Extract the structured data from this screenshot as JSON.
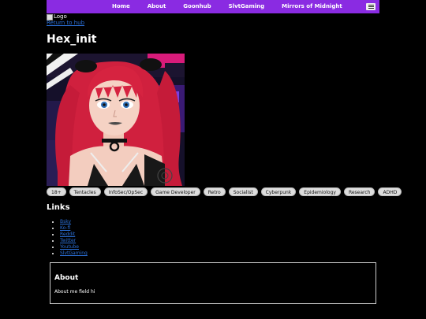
{
  "nav": {
    "items": [
      "Home",
      "About",
      "Goonhub",
      "SlvtGaming",
      "Mirrors of Midnight"
    ],
    "menu_icon": "hamburger-menu-icon",
    "background": "#8a2be2"
  },
  "header": {
    "logo_alt": "Logo",
    "back_link": "Return to hub"
  },
  "profile": {
    "name": "Hex_init",
    "avatar_icon": "avatar-portrait",
    "tags": [
      "18+",
      "Tentacles",
      "InfoSec/OpSec",
      "Game Developer",
      "Retro",
      "Socialist",
      "Cyberpunk",
      "Epidemiology",
      "Research",
      "ADHD"
    ]
  },
  "links": {
    "heading": "Links",
    "items": [
      "Bsky",
      "Ko-fi",
      "Reddit",
      "Twitter",
      "Youtube",
      "SlvtGaming"
    ]
  },
  "about": {
    "heading": "About",
    "text": "About me field hi"
  }
}
